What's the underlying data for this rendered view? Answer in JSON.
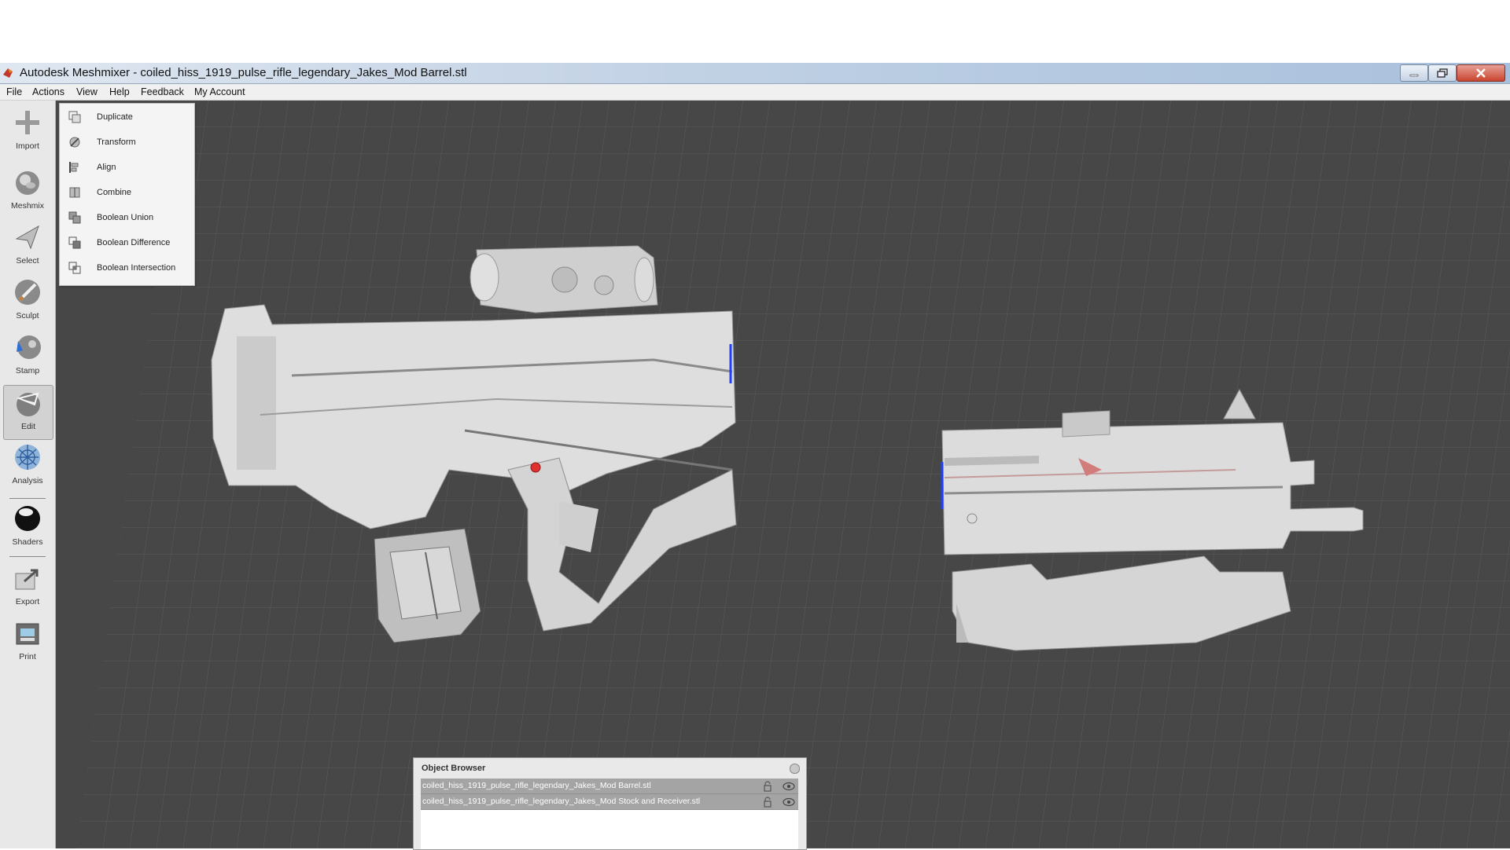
{
  "window": {
    "title": "Autodesk Meshmixer - coiled_hiss_1919_pulse_rifle_legendary_Jakes_Mod Barrel.stl",
    "icon": "meshmixer-logo-icon"
  },
  "menu": [
    "File",
    "Actions",
    "View",
    "Help",
    "Feedback",
    "My Account"
  ],
  "toolbar": [
    {
      "label": "Import",
      "icon": "plus-icon"
    },
    {
      "label": "Meshmix",
      "icon": "meshmix-bunny-icon"
    },
    {
      "label": "Select",
      "icon": "select-arrow-icon"
    },
    {
      "label": "Sculpt",
      "icon": "sculpt-brush-icon"
    },
    {
      "label": "Stamp",
      "icon": "stamp-icon"
    },
    {
      "label": "Edit",
      "icon": "edit-mesh-icon"
    },
    {
      "label": "Analysis",
      "icon": "analysis-icon"
    },
    {
      "label": "Shaders",
      "icon": "shaders-sphere-icon"
    },
    {
      "label": "Export",
      "icon": "export-icon"
    },
    {
      "label": "Print",
      "icon": "print-icon"
    }
  ],
  "active_tool": "Edit",
  "edit_menu": [
    {
      "label": "Duplicate",
      "icon": "duplicate-icon"
    },
    {
      "label": "Transform",
      "icon": "transform-icon"
    },
    {
      "label": "Align",
      "icon": "align-icon"
    },
    {
      "label": "Combine",
      "icon": "combine-icon"
    },
    {
      "label": "Boolean Union",
      "icon": "boolean-union-icon"
    },
    {
      "label": "Boolean Difference",
      "icon": "boolean-difference-icon"
    },
    {
      "label": "Boolean Intersection",
      "icon": "boolean-intersection-icon"
    }
  ],
  "object_browser": {
    "title": "Object Browser",
    "objects": [
      "coiled_hiss_1919_pulse_rifle_legendary_Jakes_Mod Barrel.stl",
      "coiled_hiss_1919_pulse_rifle_legendary_Jakes_Mod Stock and Receiver.stl"
    ]
  },
  "colors": {
    "viewport_bg": "#474747",
    "grid_line": "#5a5a5a",
    "mesh": "#d9d9d9",
    "selection_row": "#a4a4a4",
    "pivot_marker": "#e03030"
  }
}
